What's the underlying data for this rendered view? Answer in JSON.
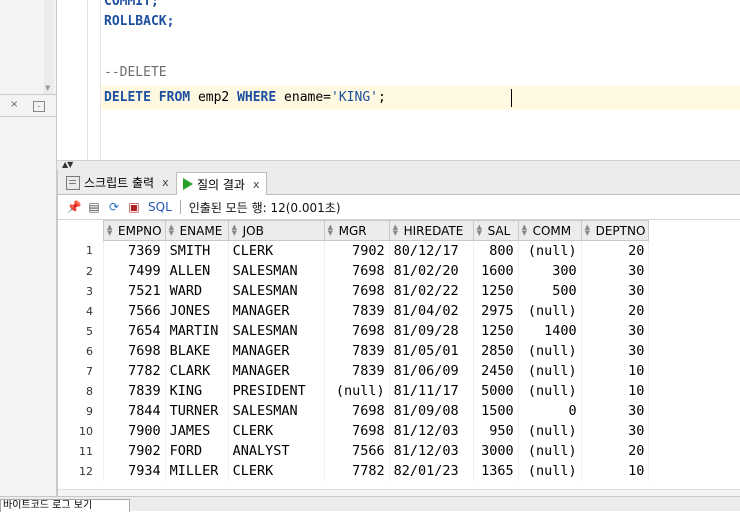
{
  "editor": {
    "line_commit": "COMMIT;",
    "line_rollback": "ROLLBACK;",
    "line_comment": "--DELETE",
    "kw_delete": "DELETE",
    "kw_from": "FROM",
    "tbl": "emp2",
    "kw_where": "WHERE",
    "cond": "ename=",
    "str": "'KING'",
    "semi": ";"
  },
  "tabs": {
    "script_output": "스크립트 출력",
    "query_result": "질의 결과",
    "close": "x"
  },
  "toolbar": {
    "sql_label": "SQL",
    "status": "인출된 모든 행: 12(0.001초)"
  },
  "grid": {
    "columns": [
      "EMPNO",
      "ENAME",
      "JOB",
      "MGR",
      "HIREDATE",
      "SAL",
      "COMM",
      "DEPTNO"
    ],
    "rows": [
      [
        "1",
        "7369",
        "SMITH",
        "CLERK",
        "7902",
        "80/12/17",
        "800",
        "(null)",
        "20"
      ],
      [
        "2",
        "7499",
        "ALLEN",
        "SALESMAN",
        "7698",
        "81/02/20",
        "1600",
        "300",
        "30"
      ],
      [
        "3",
        "7521",
        "WARD",
        "SALESMAN",
        "7698",
        "81/02/22",
        "1250",
        "500",
        "30"
      ],
      [
        "4",
        "7566",
        "JONES",
        "MANAGER",
        "7839",
        "81/04/02",
        "2975",
        "(null)",
        "20"
      ],
      [
        "5",
        "7654",
        "MARTIN",
        "SALESMAN",
        "7698",
        "81/09/28",
        "1250",
        "1400",
        "30"
      ],
      [
        "6",
        "7698",
        "BLAKE",
        "MANAGER",
        "7839",
        "81/05/01",
        "2850",
        "(null)",
        "30"
      ],
      [
        "7",
        "7782",
        "CLARK",
        "MANAGER",
        "7839",
        "81/06/09",
        "2450",
        "(null)",
        "10"
      ],
      [
        "8",
        "7839",
        "KING",
        "PRESIDENT",
        "(null)",
        "81/11/17",
        "5000",
        "(null)",
        "10"
      ],
      [
        "9",
        "7844",
        "TURNER",
        "SALESMAN",
        "7698",
        "81/09/08",
        "1500",
        "0",
        "30"
      ],
      [
        "10",
        "7900",
        "JAMES",
        "CLERK",
        "7698",
        "81/12/03",
        "950",
        "(null)",
        "30"
      ],
      [
        "11",
        "7902",
        "FORD",
        "ANALYST",
        "7566",
        "81/12/03",
        "3000",
        "(null)",
        "20"
      ],
      [
        "12",
        "7934",
        "MILLER",
        "CLERK",
        "7782",
        "82/01/23",
        "1365",
        "(null)",
        "10"
      ]
    ]
  },
  "bottom_tab": "바이트코드 로그 보기"
}
